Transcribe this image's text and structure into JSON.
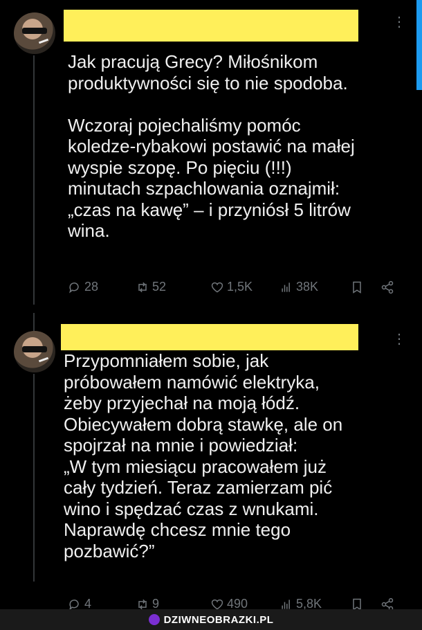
{
  "accent": "#1d9bf0",
  "redact_color": "#ffef5a",
  "posts": [
    {
      "text": "Jak pracują Grecy? Miłośnikom\nproduktywności się to nie spodoba.\n\nWczoraj pojechaliśmy pomóc\nkoledze-rybakowi postawić na małej\nwyspie szopę. Po pięciu (!!!)\nminutach szpachlowania oznajmił:\n„czas na kawę” – i przyniósł 5 litrów\nwina.",
      "stats": {
        "replies": "28",
        "reposts": "52",
        "likes": "1,5K",
        "views": "38K"
      }
    },
    {
      "text": "Przypomniałem sobie, jak\npróbowałem namówić elektryka,\nżeby przyjechał na moją łódź.\nObiecywałem dobrą stawkę, ale on\nspojrzał na mnie i powiedział:\n„W tym miesiącu pracowałem już\ncały tydzień. Teraz zamierzam pić\nwino i spędzać czas z wnukami.\nNaprawdę chcesz mnie tego\npozbawić?”",
      "stats": {
        "replies": "4",
        "reposts": "9",
        "likes": "490",
        "views": "5,8K"
      }
    }
  ],
  "icons": [
    "reply-icon",
    "repost-icon",
    "like-icon",
    "views-icon",
    "bookmark-icon",
    "share-icon",
    "more-icon"
  ],
  "watermark": "DZIWNEOBRAZKI.PL"
}
